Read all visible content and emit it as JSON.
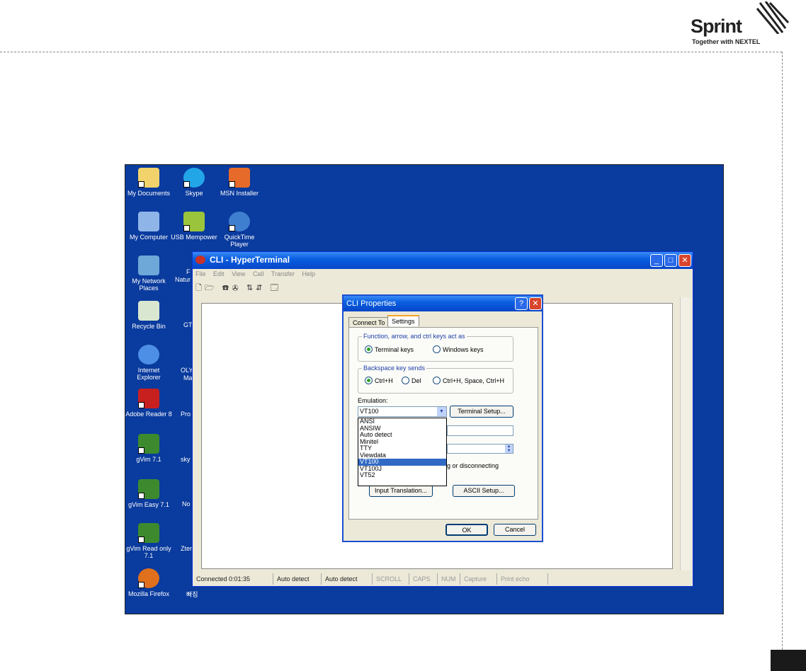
{
  "brand": {
    "logo_word": "Sprint",
    "tagline": "Together with NEXTEL",
    "colors": {
      "logo": "#222222"
    }
  },
  "desktop": {
    "background": "#0a3b9e",
    "icons": [
      {
        "label": "My Documents",
        "icon": "folder-documents-icon"
      },
      {
        "label": "Skype",
        "icon": "skype-icon"
      },
      {
        "label": "MSN Installer",
        "icon": "msn-butterfly-icon"
      },
      {
        "label": "My Computer",
        "icon": "computer-icon"
      },
      {
        "label": "USB Mempower",
        "icon": "usb-app-icon"
      },
      {
        "label": "QuickTime Player",
        "icon": "quicktime-icon"
      },
      {
        "label": "My Network Places",
        "icon": "network-icon"
      },
      {
        "label": "Recycle Bin",
        "icon": "recycle-bin-icon"
      },
      {
        "label": "Internet Explorer",
        "icon": "internet-explorer-icon"
      },
      {
        "label": "Adobe Reader 8",
        "icon": "adobe-reader-icon"
      },
      {
        "label": "gVim 7.1",
        "icon": "gvim-icon"
      },
      {
        "label": "gVim Easy 7.1",
        "icon": "gvim-icon"
      },
      {
        "label": "gVim Read only 7.1",
        "icon": "gvim-icon"
      },
      {
        "label": "Mozilla Firefox",
        "icon": "firefox-icon"
      }
    ],
    "partial_labels": [
      "F",
      "Natur",
      "GT",
      "OLY",
      "Ma",
      "Pro",
      "sky",
      "No",
      "Zter",
      "빠짐"
    ]
  },
  "hyperterminal": {
    "title": "CLI - HyperTerminal",
    "menu": [
      "File",
      "Edit",
      "View",
      "Call",
      "Transfer",
      "Help"
    ],
    "toolbar_icons": [
      "new-icon",
      "open-icon",
      "disconnect-icon",
      "send-icon",
      "receive-icon",
      "properties-icon"
    ],
    "toolbar_glyphs": "🗋🗁 ☎✇ ⇅⇵ 🗔",
    "window_buttons": {
      "minimize": "_",
      "maximize": "□",
      "close": "✕"
    },
    "status": {
      "connected": "Connected 0:01:35",
      "detect1": "Auto detect",
      "detect2": "Auto detect",
      "scroll": "SCROLL",
      "caps": "CAPS",
      "num": "NUM",
      "capture": "Capture",
      "print": "Print echo"
    }
  },
  "dialog": {
    "title": "CLI Properties",
    "help": "?",
    "close": "✕",
    "tabs": [
      "Connect To",
      "Settings"
    ],
    "active_tab": "Settings",
    "keys_group": {
      "legend": "Function, arrow, and ctrl keys act as",
      "options": [
        "Terminal keys",
        "Windows keys"
      ],
      "selected": 0
    },
    "backspace_group": {
      "legend": "Backspace key sends",
      "options": [
        "Ctrl+H",
        "Del",
        "Ctrl+H, Space, Ctrl+H"
      ],
      "selected": 0
    },
    "emulation_label": "Emulation:",
    "emulation_value": "VT100",
    "terminal_setup": "Terminal Setup...",
    "emulation_options": [
      "ANSI",
      "ANSIW",
      "Auto detect",
      "Minitel",
      "TTY",
      "Viewdata",
      "VT100",
      "VT100J",
      "VT52"
    ],
    "emulation_selected": 6,
    "hidden_text": "g or disconnecting",
    "input_translation": "Input Translation...",
    "ascii_setup": "ASCII Setup...",
    "ok": "OK",
    "cancel": "Cancel"
  }
}
